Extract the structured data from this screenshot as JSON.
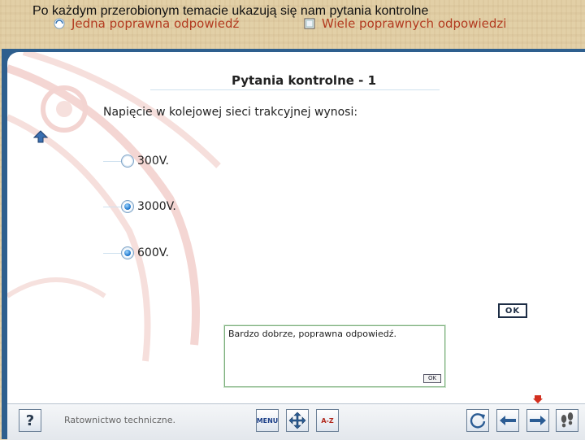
{
  "caption": "Po każdym przerobionym temacie ukazują się nam pytania kontrolne",
  "modes": {
    "single": "Jedna poprawna odpowiedź",
    "multiple": "Wiele poprawnych odpowiedzi"
  },
  "quiz": {
    "title": "Pytania kontrolne - 1",
    "question": "Napięcie w kolejowej sieci trakcyjnej wynosi:",
    "answers": [
      {
        "label": "300V.",
        "selected": false
      },
      {
        "label": "3000V.",
        "selected": true
      },
      {
        "label": "600V.",
        "selected": true
      }
    ],
    "ok_label": "OK"
  },
  "feedback": {
    "message": "Bardzo dobrze, poprawna odpowiedź.",
    "ok_label": "OK"
  },
  "footer": {
    "help_label": "?",
    "course_label": "Ratownictwo techniczne.",
    "menu_label": "MENU",
    "glossary_label": "A-Z"
  },
  "icons": [
    "radio-icon",
    "checkbox-icon",
    "up-arrow-icon",
    "down-arrow-icon",
    "help-icon",
    "menu-icon",
    "move-icon",
    "glossary-icon",
    "refresh-icon",
    "back-arrow-icon",
    "forward-arrow-icon",
    "footsteps-icon"
  ],
  "colors": {
    "frame": "#2e5f8e",
    "mode_text": "#b23a1f",
    "radio_selected": "#1670c8",
    "feedback_border": "#7fb07f"
  }
}
